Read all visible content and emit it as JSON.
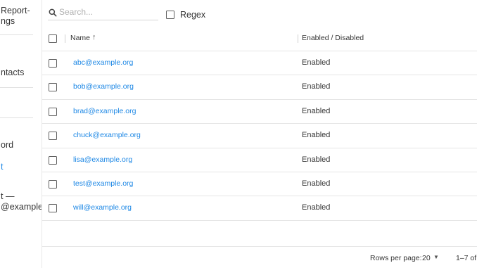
{
  "sidebar": {
    "lines": [
      {
        "text": "Report-",
        "link": false
      },
      {
        "text": "ngs",
        "link": false
      },
      {
        "text": "ntacts",
        "link": false
      },
      {
        "text": "ord",
        "link": false
      },
      {
        "text": "t",
        "link": true
      },
      {
        "text": "t —",
        "link": false
      },
      {
        "text": "@example.o",
        "link": false
      }
    ]
  },
  "toolbar": {
    "search_placeholder": "Search...",
    "search_value": "",
    "regex_label": "Regex",
    "regex_checked": false
  },
  "table": {
    "columns": [
      {
        "label": "Name",
        "sort": "asc",
        "sort_icon": "arrow-up-icon",
        "sort_glyph": "↑"
      },
      {
        "label": "Enabled / Disabled"
      }
    ],
    "rows": [
      {
        "email": "abc@example.org",
        "status": "Enabled"
      },
      {
        "email": "bob@example.org",
        "status": "Enabled"
      },
      {
        "email": "brad@example.org",
        "status": "Enabled"
      },
      {
        "email": "chuck@example.org",
        "status": "Enabled"
      },
      {
        "email": "lisa@example.org",
        "status": "Enabled"
      },
      {
        "email": "test@example.org",
        "status": "Enabled"
      },
      {
        "email": "will@example.org",
        "status": "Enabled"
      }
    ]
  },
  "footer": {
    "rows_per_page_label": "Rows per page:",
    "rows_per_page_value": "20",
    "caret_glyph": "▼",
    "range_text": "1–7 of"
  },
  "colors": {
    "link": "#1e88e5",
    "divider": "#e5e5e5",
    "checkbox_border": "#5f5f5f"
  }
}
